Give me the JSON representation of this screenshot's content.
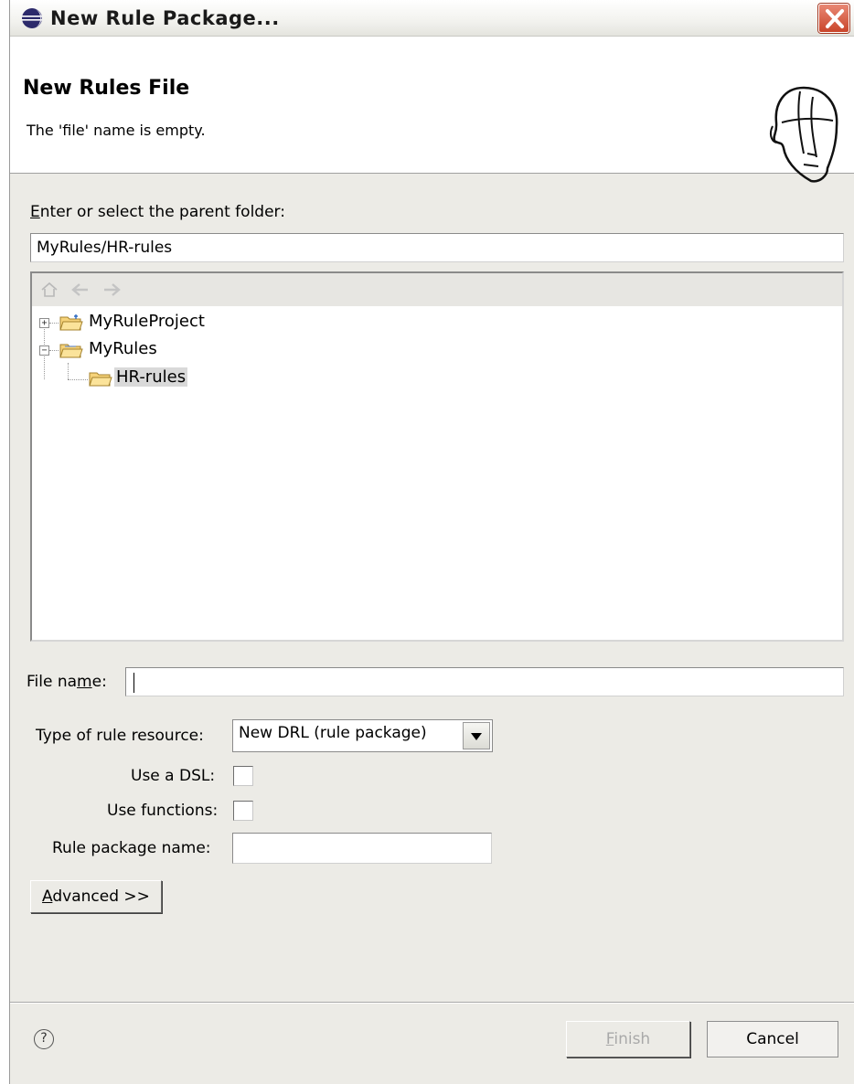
{
  "window": {
    "title": "New Rule Package..."
  },
  "header": {
    "title": "New Rules File",
    "message": "The 'file' name is empty."
  },
  "folder": {
    "label_first": "E",
    "label_rest": "nter or select the parent folder:",
    "value": "MyRules/HR-rules"
  },
  "tree": {
    "items": [
      {
        "label": "MyRuleProject",
        "expanded": false
      },
      {
        "label": "MyRules",
        "expanded": true
      },
      {
        "label": "HR-rules",
        "selected": true
      }
    ]
  },
  "file_name": {
    "label_a": "File na",
    "label_u": "m",
    "label_b": "e:",
    "value": ""
  },
  "rule_resource": {
    "label": "Type of rule resource:",
    "selected": "New DRL (rule package)"
  },
  "use_dsl": {
    "label": "Use a DSL:",
    "checked": false
  },
  "use_functions": {
    "label": "Use functions:",
    "checked": false
  },
  "package_name": {
    "label": "Rule package name:",
    "value": ""
  },
  "advanced": {
    "label_first": "A",
    "label_rest": "dvanced >>"
  },
  "footer": {
    "help": "?",
    "finish_first": "F",
    "finish_rest": "inish",
    "cancel": "Cancel"
  }
}
